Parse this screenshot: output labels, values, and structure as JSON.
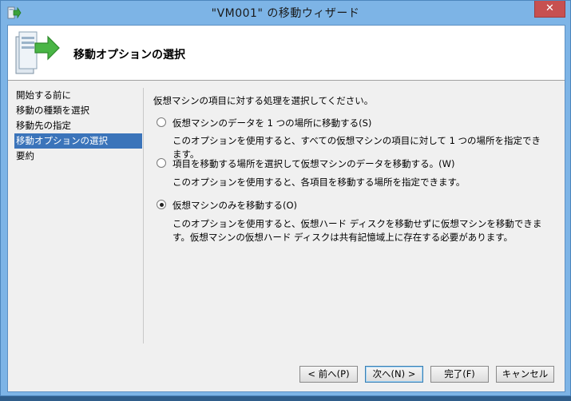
{
  "window": {
    "title": "\"VM001\" の移動ウィザード",
    "close_label": "✕"
  },
  "header": {
    "title": "移動オプションの選択"
  },
  "nav": {
    "items": [
      {
        "label": "開始する前に",
        "selected": false
      },
      {
        "label": "移動の種類を選択",
        "selected": false
      },
      {
        "label": "移動先の指定",
        "selected": false
      },
      {
        "label": "移動オプションの選択",
        "selected": true
      },
      {
        "label": "要約",
        "selected": false
      }
    ]
  },
  "content": {
    "instruction": "仮想マシンの項目に対する処理を選択してください。",
    "options": [
      {
        "label": "仮想マシンのデータを 1 つの場所に移動する(S)",
        "checked": false,
        "description": "このオプションを使用すると、すべての仮想マシンの項目に対して 1 つの場所を指定できます。"
      },
      {
        "label": "項目を移動する場所を選択して仮想マシンのデータを移動する。(W)",
        "checked": false,
        "description": "このオプションを使用すると、各項目を移動する場所を指定できます。"
      },
      {
        "label": "仮想マシンのみを移動する(O)",
        "checked": true,
        "description": "このオプションを使用すると、仮想ハード ディスクを移動せずに仮想マシンを移動できます。仮想マシンの仮想ハード ディスクは共有記憶域上に存在する必要があります。"
      }
    ]
  },
  "buttons": {
    "back": "< 前へ(P)",
    "next": "次へ(N) >",
    "finish": "完了(F)",
    "cancel": "キャンセル"
  },
  "icons": {
    "title_icon": "wizard-arrow-icon",
    "header_icon": "server-move-icon"
  },
  "colors": {
    "title_bar": "#7db4e6",
    "close_button": "#c75050",
    "selected_nav": "#3b74ba"
  }
}
